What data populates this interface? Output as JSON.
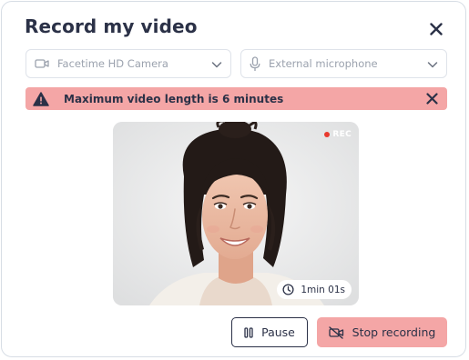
{
  "modal": {
    "title": "Record my video"
  },
  "devices": {
    "camera": {
      "label": "Facetime HD Camera",
      "icon": "video-camera-icon"
    },
    "microphone": {
      "label": "External microphone",
      "icon": "microphone-icon"
    }
  },
  "alert": {
    "message": "Maximum video length is 6 minutes",
    "icon": "warning-icon",
    "color": "#f4a6a6"
  },
  "preview": {
    "rec_label": "REC",
    "rec_color": "#e8392d",
    "elapsed": "1min 01s"
  },
  "actions": {
    "pause_label": "Pause",
    "stop_label": "Stop recording"
  },
  "colors": {
    "text": "#2b3147",
    "accent": "#f4a6a6"
  }
}
